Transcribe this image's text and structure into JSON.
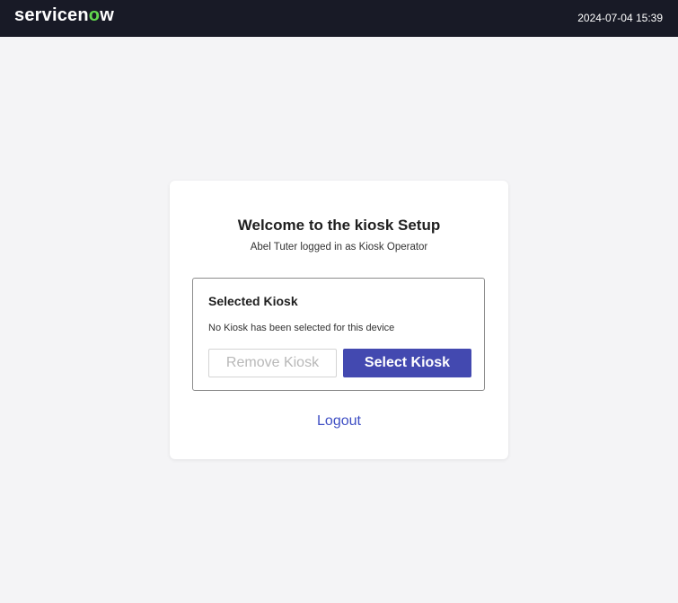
{
  "header": {
    "logo_text_prefix": "servicen",
    "logo_text_accent": "o",
    "logo_text_suffix": "w",
    "datetime": "2024-07-04 15:39"
  },
  "card": {
    "title": "Welcome to the kiosk Setup",
    "subtitle": "Abel Tuter logged in as Kiosk Operator",
    "kiosk_box": {
      "title": "Selected Kiosk",
      "message": "No Kiosk has been selected for this device",
      "remove_label": "Remove Kiosk",
      "select_label": "Select Kiosk"
    },
    "logout_label": "Logout"
  },
  "colors": {
    "header_bg": "#181a26",
    "brand_accent": "#62d84e",
    "primary_button": "#4349b0",
    "link": "#3f4fc4",
    "page_bg": "#f4f4f6"
  }
}
